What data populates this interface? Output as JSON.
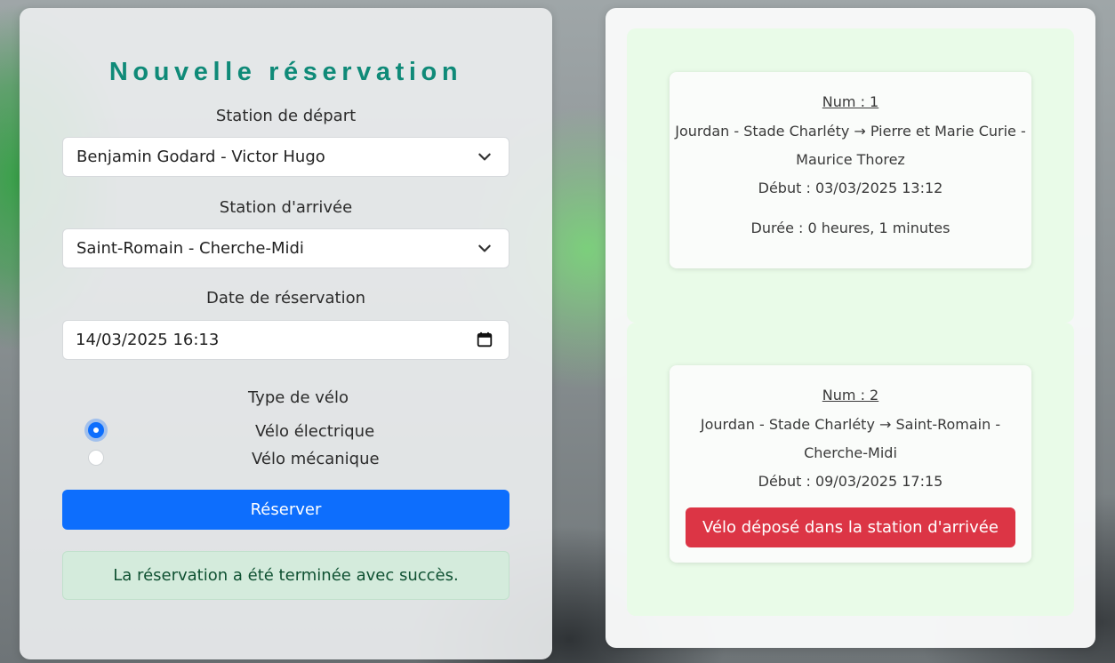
{
  "form": {
    "title": "Nouvelle réservation",
    "departure_label": "Station de départ",
    "departure_value": "Benjamin Godard - Victor Hugo",
    "arrival_label": "Station d'arrivée",
    "arrival_value": "Saint-Romain - Cherche-Midi",
    "date_label": "Date de réservation",
    "date_value": "14/03/2025 16:13",
    "bike_type_label": "Type de vélo",
    "bike_options": [
      {
        "label": "Vélo électrique",
        "checked": true
      },
      {
        "label": "Vélo mécanique",
        "checked": false
      }
    ],
    "submit_label": "Réserver",
    "success_message": "La réservation a été terminée avec succès."
  },
  "reservations": [
    {
      "num": "Num : 1",
      "route_line1": "Jourdan - Stade Charléty → Pierre et Marie Curie -",
      "route_line2": "Maurice Thorez",
      "start": "Début : 03/03/2025 13:12",
      "duration": "Durée : 0 heures, 1 minutes"
    },
    {
      "num": "Num : 2",
      "route_line1": "Jourdan - Stade Charléty → Saint-Romain -",
      "route_line2": "Cherche-Midi",
      "start": "Début : 09/03/2025 17:15",
      "action_label": "Vélo déposé dans la station d'arrivée"
    }
  ],
  "colors": {
    "primary": "#0d6efd",
    "danger": "#dc3545",
    "title": "#0f8a78",
    "success_bg": "#d4ebdc"
  }
}
